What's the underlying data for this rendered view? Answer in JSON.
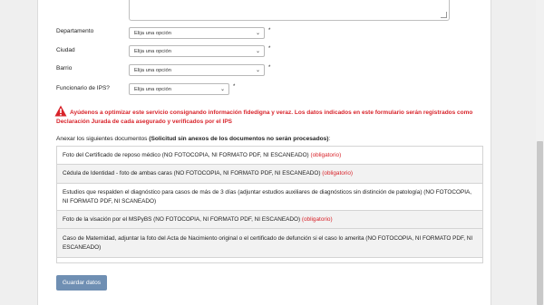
{
  "form": {
    "fields": [
      {
        "label": "Departamento",
        "placeholder": "Elija una opción",
        "required_mark": "*"
      },
      {
        "label": "Ciudad",
        "placeholder": "Elija una opción",
        "required_mark": "*"
      },
      {
        "label": "Barrio",
        "placeholder": "Elija una opción",
        "required_mark": "*"
      },
      {
        "label": "Funcionario de IPS?",
        "placeholder": "Elija una opción",
        "required_mark": "*"
      }
    ],
    "warning": "Ayúdenos a optimizar este servicio consignando información fidedigna y veraz. Los datos indicados en este formulario serán registrados como Declaración Jurada de cada asegurado y verificados por el IPS",
    "annex_title": "Anexar los siguientes documentos",
    "annex_note": "(Solicitud sin anexos de los documentos no serán procesados)",
    "annex_suffix": ":",
    "documents": [
      {
        "text": "Foto del Certificado de reposo médico (NO FOTOCOPIA, NI FORMATO PDF, NI ESCANEADO)",
        "mandatory": "(obligatorio)"
      },
      {
        "text": "Cédula de Identidad - foto de ambas caras (NO FOTOCOPIA, NI FORMATO PDF, NI ESCANEADO)",
        "mandatory": "(obligatorio)"
      },
      {
        "text": "Estudios que respalden el diagnóstico para casos de más de 3 días (adjuntar estudios auxiliares de diagnósticos sin distinción de patología) (NO FOTOCOPIA, NI FORMATO PDF, NI SCANEADO)",
        "mandatory": ""
      },
      {
        "text": "Foto de la visación por el MSPyBS (NO FOTOCOPIA, NI FORMATO PDF, NI ESCANEADO)",
        "mandatory": "(obligatorio)"
      },
      {
        "text": "Caso de Maternidad, adjuntar la foto del Acta de Nacimiento original o el certificado de defunción si el caso lo amerita (NO FOTOCOPIA, NI FORMATO PDF, NI ESCANEADO)",
        "mandatory": ""
      }
    ],
    "save_label": "Guardar datos"
  },
  "icons": {
    "warning": "warning-triangle-icon",
    "dropdown": "chevron-down-icon"
  },
  "colors": {
    "warning_red": "#d8232a",
    "button_blue": "#6f8fb3",
    "alt_row": "#f2f2f2"
  }
}
